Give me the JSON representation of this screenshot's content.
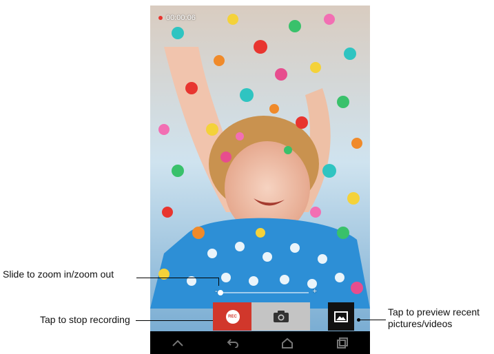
{
  "screen": {
    "recording_timer": "00:00:06",
    "rec_button_label": "REC",
    "zoom": {
      "minus": "-",
      "plus": "+",
      "level": 0.0
    }
  },
  "nav": {
    "back_icon": "back-icon",
    "home_icon": "home-icon",
    "recent_icon": "recent-apps-icon",
    "menu_icon": "chevron-up-icon"
  },
  "callouts": {
    "zoom": "Slide to zoom in/zoom out",
    "stop": "Tap to stop recording",
    "preview_line1": "Tap to preview recent",
    "preview_line2": "pictures/videos"
  },
  "colors": {
    "rec_red": "#d1372b",
    "shutter_gray": "#c4c4c4",
    "gallery_black": "#111111"
  }
}
